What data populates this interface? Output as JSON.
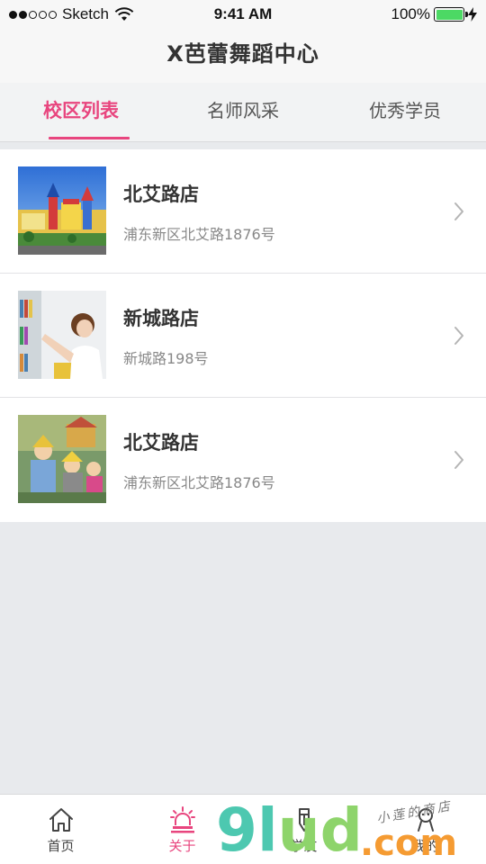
{
  "status_bar": {
    "carrier": "Sketch",
    "time": "9:41 AM",
    "battery": "100%",
    "signal_dots_filled": 2,
    "signal_dots_total": 5
  },
  "nav": {
    "title": "X芭蕾舞蹈中心"
  },
  "tabs": [
    {
      "label": "校区列表",
      "active": true
    },
    {
      "label": "名师风采",
      "active": false
    },
    {
      "label": "优秀学员",
      "active": false
    }
  ],
  "stores": [
    {
      "name": "北艾路店",
      "address": "浦东新区北艾路1876号",
      "image": "kindergarten-building"
    },
    {
      "name": "新城路店",
      "address": "新城路198号",
      "image": "woman-bookshelf"
    },
    {
      "name": "北艾路店",
      "address": "浦东新区北艾路1876号",
      "image": "children-costumes"
    }
  ],
  "tab_bar": [
    {
      "label": "首页",
      "icon": "home-icon",
      "active": false
    },
    {
      "label": "关于",
      "icon": "alarm-light-icon",
      "active": true
    },
    {
      "label": "学友",
      "icon": "pencil-icon",
      "active": false
    },
    {
      "label": "我的",
      "icon": "user-icon",
      "active": false
    }
  ],
  "watermark": {
    "main": "9lud",
    "suffix": ".com",
    "script": "小莲的商店"
  },
  "colors": {
    "accent": "#e8457e",
    "background": "#e8eaed",
    "battery": "#4cd964"
  }
}
